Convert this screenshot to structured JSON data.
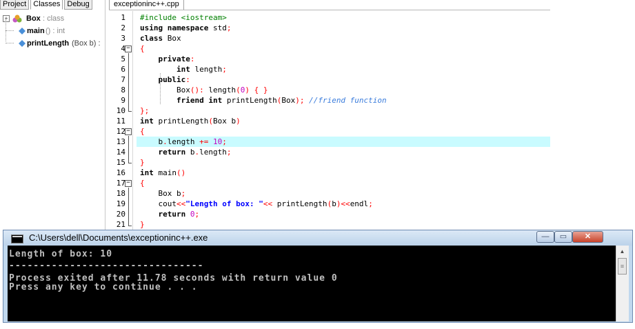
{
  "left_tabs": [
    "Project",
    "Classes",
    "Debug"
  ],
  "tree": {
    "class_name": "Box",
    "class_type": " : class",
    "items": [
      {
        "name": "main",
        "suffix": " () : int"
      },
      {
        "name": "printLength",
        "suffix": " (Box b) :"
      }
    ]
  },
  "editor": {
    "tab_label": "exceptioninc++.cpp",
    "highlight_line": 13
  },
  "code_lines": [
    {
      "num": "1",
      "tokens": [
        [
          "pp",
          "#include <iostream>"
        ]
      ]
    },
    {
      "num": "2",
      "tokens": [
        [
          "k",
          "using namespace"
        ],
        [
          "t",
          " std"
        ],
        [
          "sym",
          ";"
        ]
      ]
    },
    {
      "num": "3",
      "tokens": [
        [
          "k",
          "class"
        ],
        [
          "t",
          " Box"
        ]
      ]
    },
    {
      "num": "4",
      "tokens": [
        [
          "sym",
          "{"
        ]
      ]
    },
    {
      "num": "5",
      "tokens": [
        [
          "t",
          "    "
        ],
        [
          "k",
          "private"
        ],
        [
          "sym",
          ":"
        ]
      ]
    },
    {
      "num": "6",
      "tokens": [
        [
          "t",
          "        "
        ],
        [
          "k",
          "int"
        ],
        [
          "t",
          " length"
        ],
        [
          "sym",
          ";"
        ]
      ]
    },
    {
      "num": "7",
      "tokens": [
        [
          "t",
          "    "
        ],
        [
          "k",
          "public"
        ],
        [
          "sym",
          ":"
        ]
      ]
    },
    {
      "num": "8",
      "tokens": [
        [
          "t",
          "        Box"
        ],
        [
          "sym",
          "()"
        ],
        [
          "sym",
          ":"
        ],
        [
          "t",
          " length"
        ],
        [
          "sym",
          "("
        ],
        [
          "n",
          "0"
        ],
        [
          "sym",
          ")"
        ],
        [
          "t",
          " "
        ],
        [
          "sym",
          "{ }"
        ]
      ]
    },
    {
      "num": "9",
      "tokens": [
        [
          "t",
          "        "
        ],
        [
          "k",
          "friend int"
        ],
        [
          "t",
          " printLength"
        ],
        [
          "sym",
          "("
        ],
        [
          "t",
          "Box"
        ],
        [
          "sym",
          ");"
        ],
        [
          "t",
          " "
        ],
        [
          "c",
          "//friend function"
        ]
      ]
    },
    {
      "num": "10",
      "tokens": [
        [
          "sym",
          "};"
        ]
      ]
    },
    {
      "num": "11",
      "tokens": [
        [
          "k",
          "int"
        ],
        [
          "t",
          " printLength"
        ],
        [
          "sym",
          "("
        ],
        [
          "t",
          "Box b"
        ],
        [
          "sym",
          ")"
        ]
      ]
    },
    {
      "num": "12",
      "tokens": [
        [
          "sym",
          "{"
        ]
      ]
    },
    {
      "num": "13",
      "tokens": [
        [
          "t",
          "    b"
        ],
        [
          "sym",
          "."
        ],
        [
          "t",
          "length "
        ],
        [
          "sym",
          "+="
        ],
        [
          "t",
          " "
        ],
        [
          "n",
          "10"
        ],
        [
          "sym",
          ";"
        ]
      ]
    },
    {
      "num": "14",
      "tokens": [
        [
          "t",
          "    "
        ],
        [
          "k",
          "return"
        ],
        [
          "t",
          " b"
        ],
        [
          "sym",
          "."
        ],
        [
          "t",
          "length"
        ],
        [
          "sym",
          ";"
        ]
      ]
    },
    {
      "num": "15",
      "tokens": [
        [
          "sym",
          "}"
        ]
      ]
    },
    {
      "num": "16",
      "tokens": [
        [
          "k",
          "int"
        ],
        [
          "t",
          " main"
        ],
        [
          "sym",
          "()"
        ]
      ]
    },
    {
      "num": "17",
      "tokens": [
        [
          "sym",
          "{"
        ]
      ]
    },
    {
      "num": "18",
      "tokens": [
        [
          "t",
          "    Box b"
        ],
        [
          "sym",
          ";"
        ]
      ]
    },
    {
      "num": "19",
      "tokens": [
        [
          "t",
          "    cout"
        ],
        [
          "sym",
          "<<"
        ],
        [
          "s",
          "\"Length of box: \""
        ],
        [
          "sym",
          "<<"
        ],
        [
          "t",
          " printLength"
        ],
        [
          "sym",
          "("
        ],
        [
          "t",
          "b"
        ],
        [
          "sym",
          ")<<"
        ],
        [
          "t",
          "endl"
        ],
        [
          "sym",
          ";"
        ]
      ]
    },
    {
      "num": "20",
      "tokens": [
        [
          "t",
          "    "
        ],
        [
          "k",
          "return"
        ],
        [
          "t",
          " "
        ],
        [
          "n",
          "0"
        ],
        [
          "sym",
          ";"
        ]
      ]
    },
    {
      "num": "21",
      "tokens": [
        [
          "sym",
          "}"
        ]
      ]
    }
  ],
  "console": {
    "title": "C:\\Users\\dell\\Documents\\exceptioninc++.exe",
    "lines": [
      "Length of box: 10",
      "",
      "--------------------------------",
      "Process exited after 11.78 seconds with return value 0",
      "Press any key to continue . . ."
    ],
    "minimize_label": "—",
    "maximize_label": "▭",
    "close_label": "✕"
  }
}
